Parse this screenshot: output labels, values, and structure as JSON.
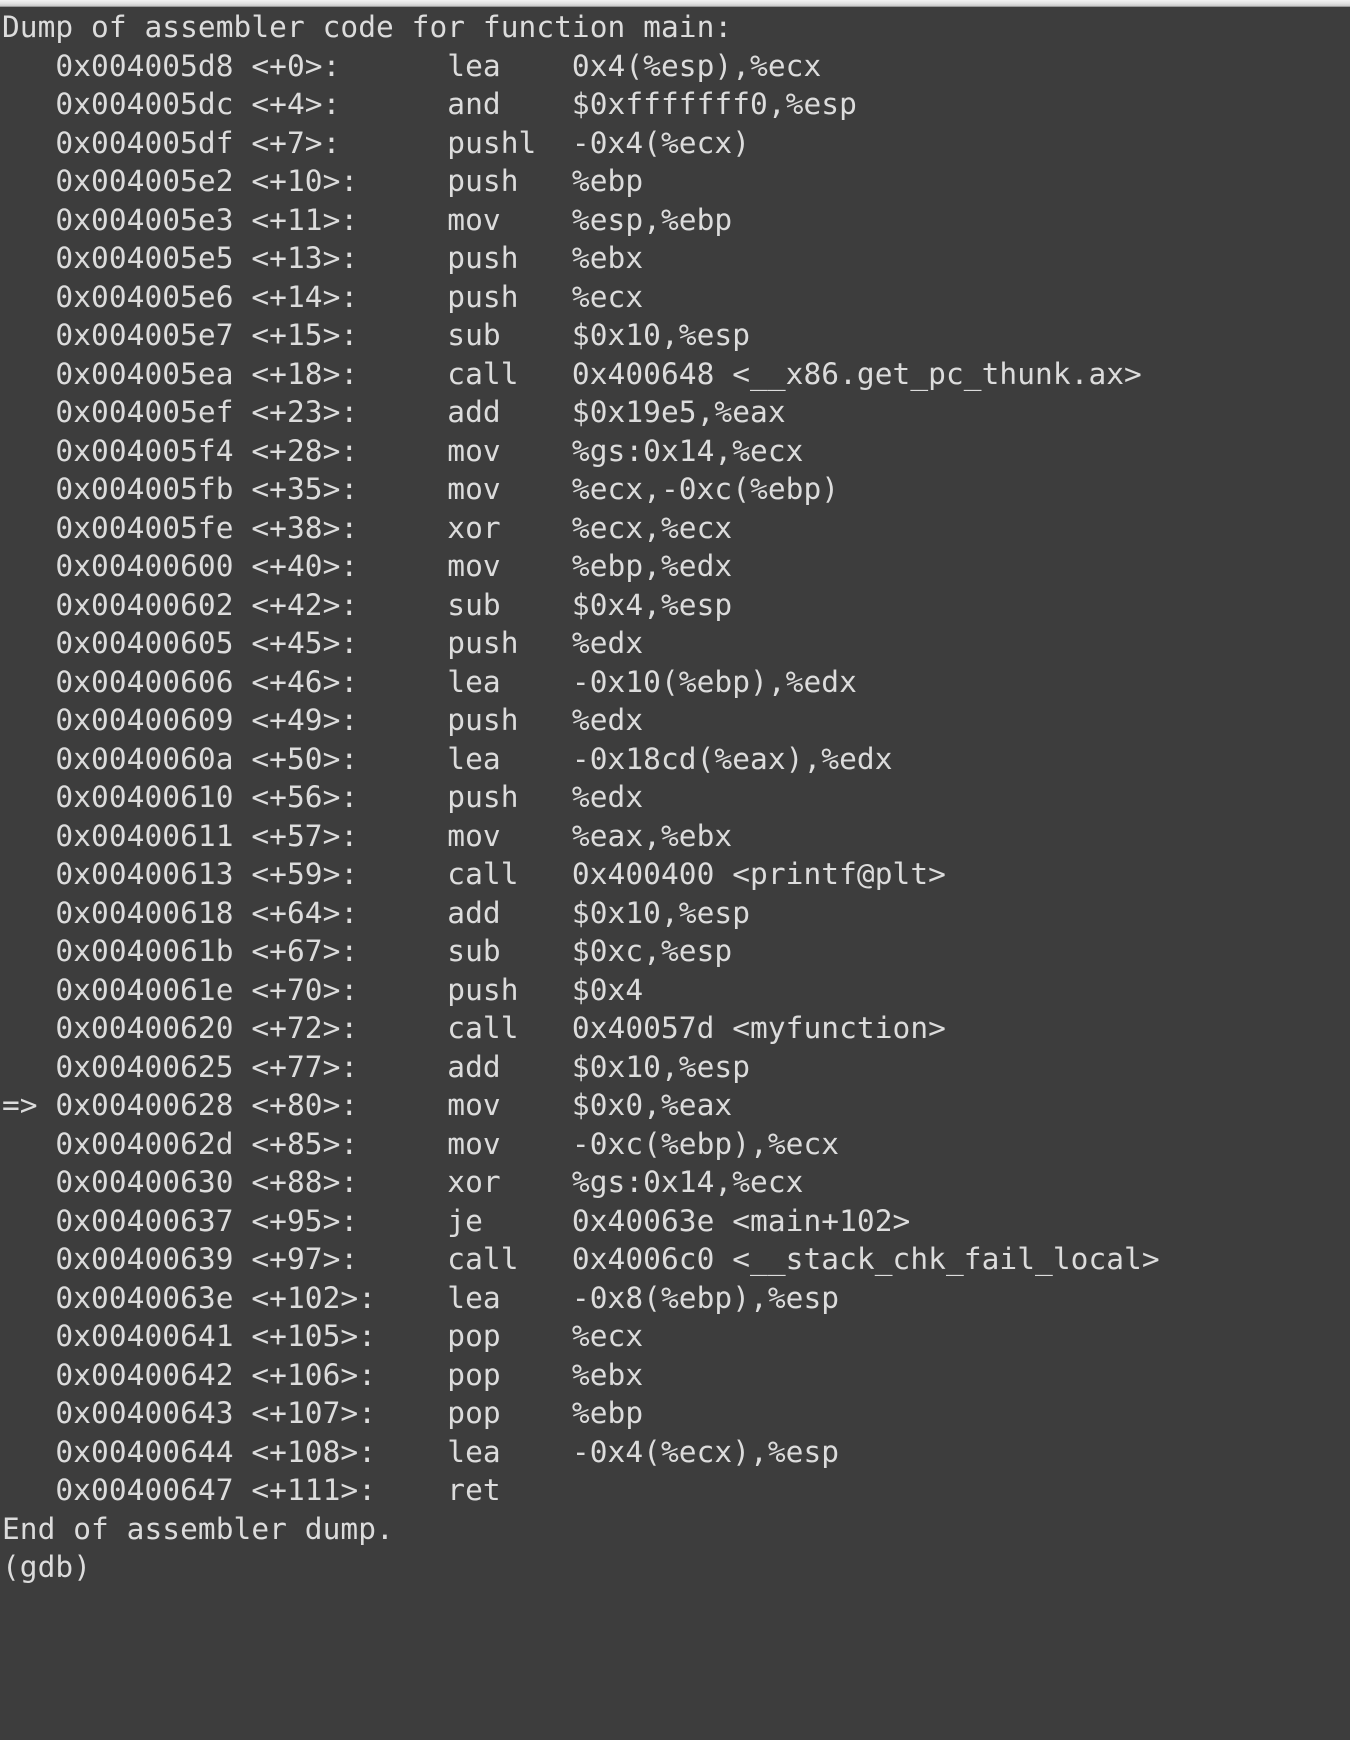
{
  "window": {
    "titlebar_present": true,
    "background_color": "#3d3d3d",
    "foreground_color": "#dcdcdc"
  },
  "terminal": {
    "header": "Dump of assembler code for function main:",
    "footer": "End of assembler dump.",
    "prompt": "(gdb)",
    "function_name": "main",
    "current_instruction_marker": "=>",
    "lines": [
      "Dump of assembler code for function main:",
      "   0x004005d8 <+0>:\tlea    0x4(%esp),%ecx",
      "   0x004005dc <+4>:\tand    $0xfffffff0,%esp",
      "   0x004005df <+7>:\tpushl  -0x4(%ecx)",
      "   0x004005e2 <+10>:\tpush   %ebp",
      "   0x004005e3 <+11>:\tmov    %esp,%ebp",
      "   0x004005e5 <+13>:\tpush   %ebx",
      "   0x004005e6 <+14>:\tpush   %ecx",
      "   0x004005e7 <+15>:\tsub    $0x10,%esp",
      "   0x004005ea <+18>:\tcall   0x400648 <__x86.get_pc_thunk.ax>",
      "   0x004005ef <+23>:\tadd    $0x19e5,%eax",
      "   0x004005f4 <+28>:\tmov    %gs:0x14,%ecx",
      "   0x004005fb <+35>:\tmov    %ecx,-0xc(%ebp)",
      "   0x004005fe <+38>:\txor    %ecx,%ecx",
      "   0x00400600 <+40>:\tmov    %ebp,%edx",
      "   0x00400602 <+42>:\tsub    $0x4,%esp",
      "   0x00400605 <+45>:\tpush   %edx",
      "   0x00400606 <+46>:\tlea    -0x10(%ebp),%edx",
      "   0x00400609 <+49>:\tpush   %edx",
      "   0x0040060a <+50>:\tlea    -0x18cd(%eax),%edx",
      "   0x00400610 <+56>:\tpush   %edx",
      "   0x00400611 <+57>:\tmov    %eax,%ebx",
      "   0x00400613 <+59>:\tcall   0x400400 <printf@plt>",
      "   0x00400618 <+64>:\tadd    $0x10,%esp",
      "   0x0040061b <+67>:\tsub    $0xc,%esp",
      "   0x0040061e <+70>:\tpush   $0x4",
      "   0x00400620 <+72>:\tcall   0x40057d <myfunction>",
      "   0x00400625 <+77>:\tadd    $0x10,%esp",
      "=> 0x00400628 <+80>:\tmov    $0x0,%eax",
      "   0x0040062d <+85>:\tmov    -0xc(%ebp),%ecx",
      "   0x00400630 <+88>:\txor    %gs:0x14,%ecx",
      "   0x00400637 <+95>:\tje     0x40063e <main+102>",
      "   0x00400639 <+97>:\tcall   0x4006c0 <__stack_chk_fail_local>",
      "   0x0040063e <+102>:\tlea    -0x8(%ebp),%esp",
      "   0x00400641 <+105>:\tpop    %ecx",
      "   0x00400642 <+106>:\tpop    %ebx",
      "   0x00400643 <+107>:\tpop    %ebp",
      "   0x00400644 <+108>:\tlea    -0x4(%ecx),%esp",
      "   0x00400647 <+111>:\tret",
      "End of assembler dump.",
      "(gdb)"
    ],
    "instructions": [
      {
        "marker": "",
        "address": "0x004005d8",
        "offset": "<+0>:",
        "mnemonic": "lea",
        "operands": "0x4(%esp),%ecx"
      },
      {
        "marker": "",
        "address": "0x004005dc",
        "offset": "<+4>:",
        "mnemonic": "and",
        "operands": "$0xfffffff0,%esp"
      },
      {
        "marker": "",
        "address": "0x004005df",
        "offset": "<+7>:",
        "mnemonic": "pushl",
        "operands": "-0x4(%ecx)"
      },
      {
        "marker": "",
        "address": "0x004005e2",
        "offset": "<+10>:",
        "mnemonic": "push",
        "operands": "%ebp"
      },
      {
        "marker": "",
        "address": "0x004005e3",
        "offset": "<+11>:",
        "mnemonic": "mov",
        "operands": "%esp,%ebp"
      },
      {
        "marker": "",
        "address": "0x004005e5",
        "offset": "<+13>:",
        "mnemonic": "push",
        "operands": "%ebx"
      },
      {
        "marker": "",
        "address": "0x004005e6",
        "offset": "<+14>:",
        "mnemonic": "push",
        "operands": "%ecx"
      },
      {
        "marker": "",
        "address": "0x004005e7",
        "offset": "<+15>:",
        "mnemonic": "sub",
        "operands": "$0x10,%esp"
      },
      {
        "marker": "",
        "address": "0x004005ea",
        "offset": "<+18>:",
        "mnemonic": "call",
        "operands": "0x400648 <__x86.get_pc_thunk.ax>"
      },
      {
        "marker": "",
        "address": "0x004005ef",
        "offset": "<+23>:",
        "mnemonic": "add",
        "operands": "$0x19e5,%eax"
      },
      {
        "marker": "",
        "address": "0x004005f4",
        "offset": "<+28>:",
        "mnemonic": "mov",
        "operands": "%gs:0x14,%ecx"
      },
      {
        "marker": "",
        "address": "0x004005fb",
        "offset": "<+35>:",
        "mnemonic": "mov",
        "operands": "%ecx,-0xc(%ebp)"
      },
      {
        "marker": "",
        "address": "0x004005fe",
        "offset": "<+38>:",
        "mnemonic": "xor",
        "operands": "%ecx,%ecx"
      },
      {
        "marker": "",
        "address": "0x00400600",
        "offset": "<+40>:",
        "mnemonic": "mov",
        "operands": "%ebp,%edx"
      },
      {
        "marker": "",
        "address": "0x00400602",
        "offset": "<+42>:",
        "mnemonic": "sub",
        "operands": "$0x4,%esp"
      },
      {
        "marker": "",
        "address": "0x00400605",
        "offset": "<+45>:",
        "mnemonic": "push",
        "operands": "%edx"
      },
      {
        "marker": "",
        "address": "0x00400606",
        "offset": "<+46>:",
        "mnemonic": "lea",
        "operands": "-0x10(%ebp),%edx"
      },
      {
        "marker": "",
        "address": "0x00400609",
        "offset": "<+49>:",
        "mnemonic": "push",
        "operands": "%edx"
      },
      {
        "marker": "",
        "address": "0x0040060a",
        "offset": "<+50>:",
        "mnemonic": "lea",
        "operands": "-0x18cd(%eax),%edx"
      },
      {
        "marker": "",
        "address": "0x00400610",
        "offset": "<+56>:",
        "mnemonic": "push",
        "operands": "%edx"
      },
      {
        "marker": "",
        "address": "0x00400611",
        "offset": "<+57>:",
        "mnemonic": "mov",
        "operands": "%eax,%ebx"
      },
      {
        "marker": "",
        "address": "0x00400613",
        "offset": "<+59>:",
        "mnemonic": "call",
        "operands": "0x400400 <printf@plt>"
      },
      {
        "marker": "",
        "address": "0x00400618",
        "offset": "<+64>:",
        "mnemonic": "add",
        "operands": "$0x10,%esp"
      },
      {
        "marker": "",
        "address": "0x0040061b",
        "offset": "<+67>:",
        "mnemonic": "sub",
        "operands": "$0xc,%esp"
      },
      {
        "marker": "",
        "address": "0x0040061e",
        "offset": "<+70>:",
        "mnemonic": "push",
        "operands": "$0x4"
      },
      {
        "marker": "",
        "address": "0x00400620",
        "offset": "<+72>:",
        "mnemonic": "call",
        "operands": "0x40057d <myfunction>"
      },
      {
        "marker": "",
        "address": "0x00400625",
        "offset": "<+77>:",
        "mnemonic": "add",
        "operands": "$0x10,%esp"
      },
      {
        "marker": "=>",
        "address": "0x00400628",
        "offset": "<+80>:",
        "mnemonic": "mov",
        "operands": "$0x0,%eax"
      },
      {
        "marker": "",
        "address": "0x0040062d",
        "offset": "<+85>:",
        "mnemonic": "mov",
        "operands": "-0xc(%ebp),%ecx"
      },
      {
        "marker": "",
        "address": "0x00400630",
        "offset": "<+88>:",
        "mnemonic": "xor",
        "operands": "%gs:0x14,%ecx"
      },
      {
        "marker": "",
        "address": "0x00400637",
        "offset": "<+95>:",
        "mnemonic": "je",
        "operands": "0x40063e <main+102>"
      },
      {
        "marker": "",
        "address": "0x00400639",
        "offset": "<+97>:",
        "mnemonic": "call",
        "operands": "0x4006c0 <__stack_chk_fail_local>"
      },
      {
        "marker": "",
        "address": "0x0040063e",
        "offset": "<+102>:",
        "mnemonic": "lea",
        "operands": "-0x8(%ebp),%esp"
      },
      {
        "marker": "",
        "address": "0x00400641",
        "offset": "<+105>:",
        "mnemonic": "pop",
        "operands": "%ecx"
      },
      {
        "marker": "",
        "address": "0x00400642",
        "offset": "<+106>:",
        "mnemonic": "pop",
        "operands": "%ebx"
      },
      {
        "marker": "",
        "address": "0x00400643",
        "offset": "<+107>:",
        "mnemonic": "pop",
        "operands": "%ebp"
      },
      {
        "marker": "",
        "address": "0x00400644",
        "offset": "<+108>:",
        "mnemonic": "lea",
        "operands": "-0x4(%ecx),%esp"
      },
      {
        "marker": "",
        "address": "0x00400647",
        "offset": "<+111>:",
        "mnemonic": "ret",
        "operands": ""
      }
    ]
  }
}
